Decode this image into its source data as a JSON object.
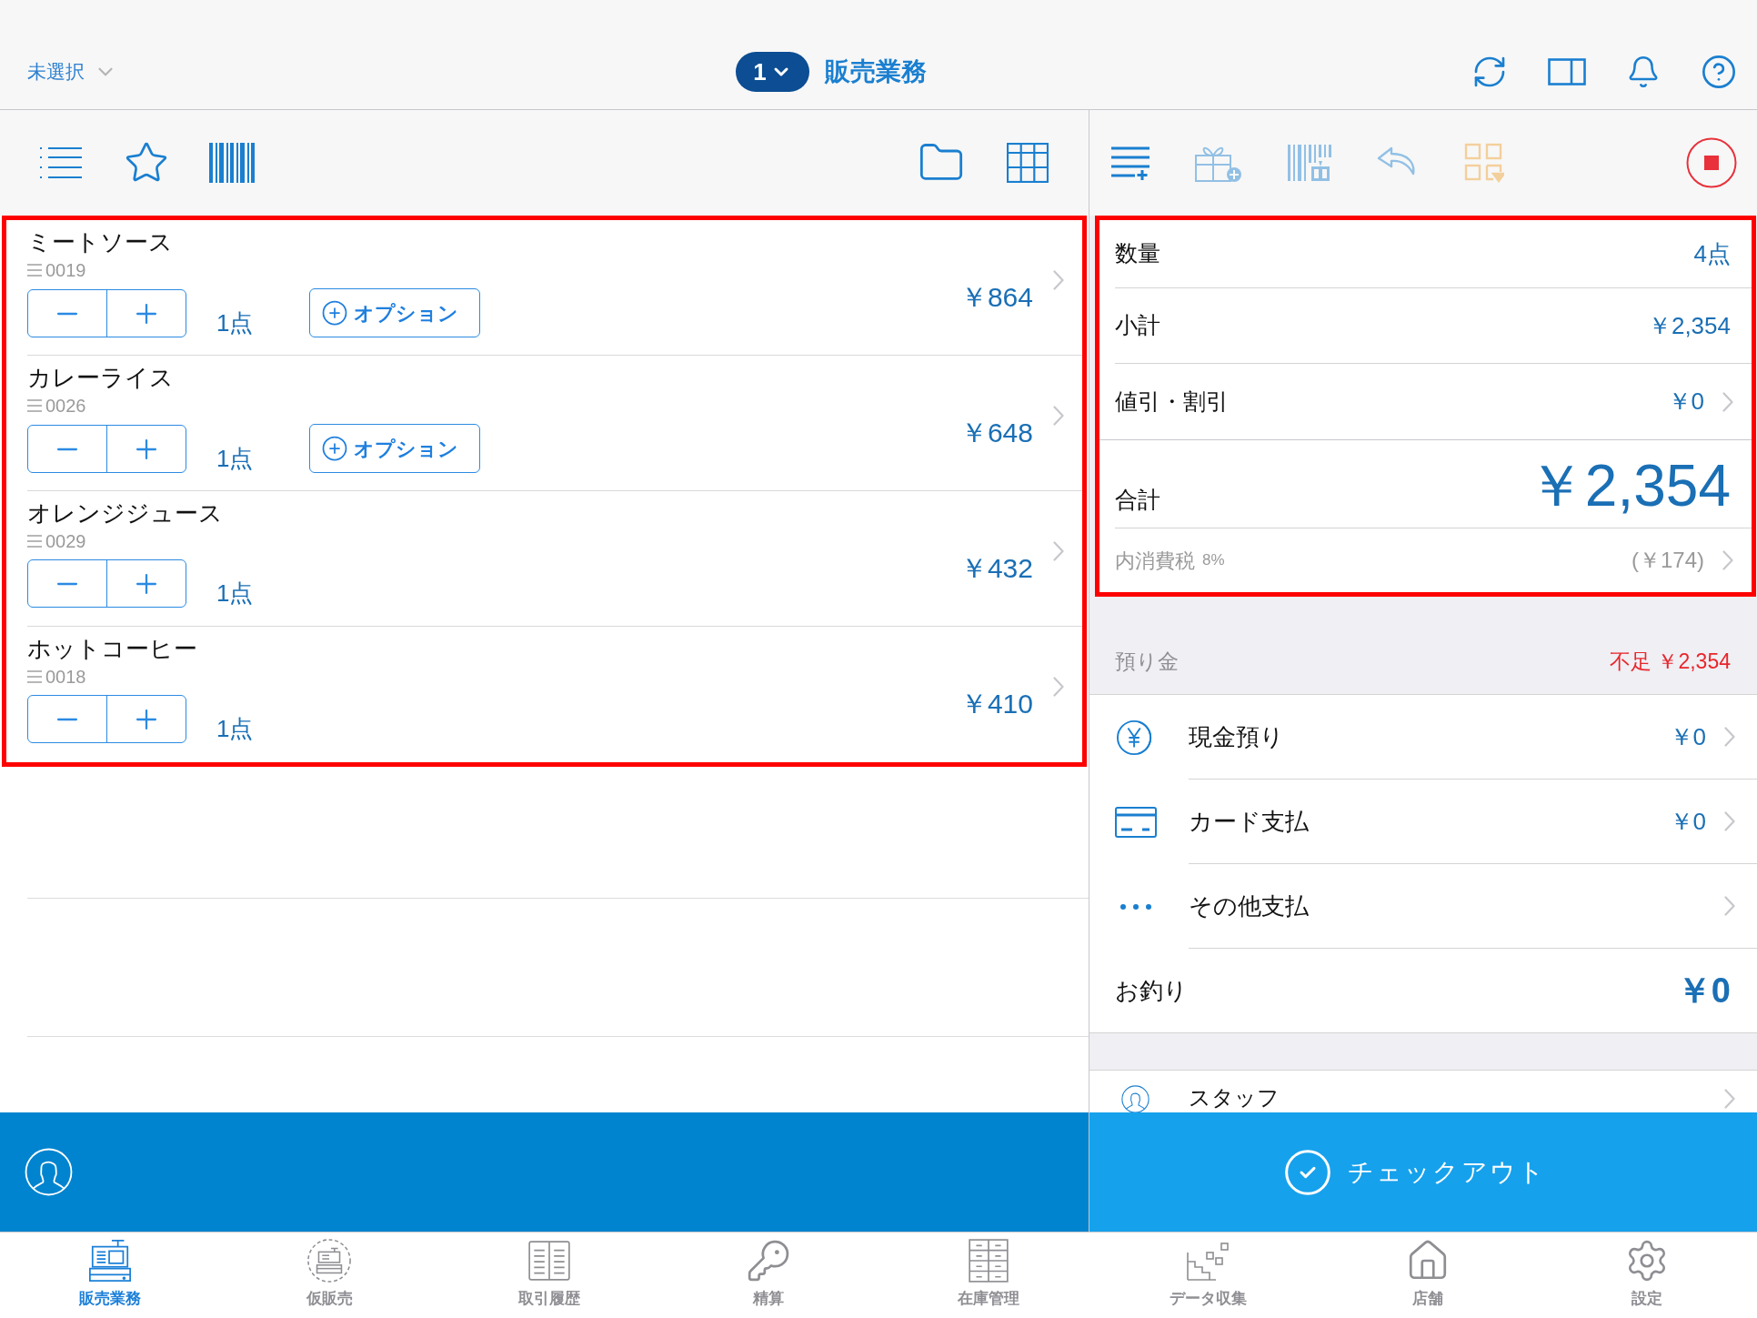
{
  "header": {
    "store_selector": "未選択",
    "register_number": "1",
    "title": "販売業務"
  },
  "order_toolbar": [
    {
      "kind": "add-line",
      "disabled": false
    },
    {
      "kind": "gift",
      "disabled": true
    },
    {
      "kind": "barcode",
      "disabled": true
    },
    {
      "kind": "return",
      "disabled": true
    },
    {
      "kind": "grid",
      "disabled": true
    }
  ],
  "cart_items": [
    {
      "name": "ミートソース",
      "code": "0019",
      "quantity": "1点",
      "option_button": "オプション",
      "price": "￥864"
    },
    {
      "name": "カレーライス",
      "code": "0026",
      "quantity": "1点",
      "option_button": "オプション",
      "price": "￥648"
    },
    {
      "name": "オレンジジュース",
      "code": "0029",
      "quantity": "1点",
      "price": "￥432"
    },
    {
      "name": "ホットコーヒー",
      "code": "0018",
      "quantity": "1点",
      "price": "￥410"
    }
  ],
  "summary": {
    "rows": [
      {
        "kind": "info",
        "label": "数量",
        "value": "4点"
      },
      {
        "kind": "info",
        "label": "小計",
        "value": "￥2,354"
      },
      {
        "kind": "detail",
        "label": "値引・割引",
        "value": "￥0"
      }
    ],
    "total": {
      "label": "合計",
      "value": "￥2,354"
    },
    "tax": {
      "label": "内消費税",
      "rate": "8%",
      "value": "(￥174)"
    }
  },
  "deposit": {
    "label": "預り金",
    "status": "不足 ￥2,354"
  },
  "payments": [
    {
      "kind": "cash",
      "label": "現金預り",
      "amount": "￥0"
    },
    {
      "kind": "card",
      "label": "カード支払",
      "amount": "￥0"
    },
    {
      "kind": "other",
      "label": "その他支払"
    }
  ],
  "change": {
    "label": "お釣り",
    "value": "￥0"
  },
  "staff": {
    "label": "スタッフ"
  },
  "checkout": {
    "label": "チェックアウト"
  },
  "tabs": [
    {
      "kind": "register",
      "label": "販売業務",
      "selected": true
    },
    {
      "kind": "hold",
      "label": "仮販売",
      "selected": false
    },
    {
      "kind": "history",
      "label": "取引履歴",
      "selected": false
    },
    {
      "kind": "settlement",
      "label": "精算",
      "selected": false
    },
    {
      "kind": "inventory",
      "label": "在庫管理",
      "selected": false
    },
    {
      "kind": "data",
      "label": "データ収集",
      "selected": false
    },
    {
      "kind": "store",
      "label": "店舗",
      "selected": false
    },
    {
      "kind": "settings",
      "label": "設定",
      "selected": false
    }
  ]
}
